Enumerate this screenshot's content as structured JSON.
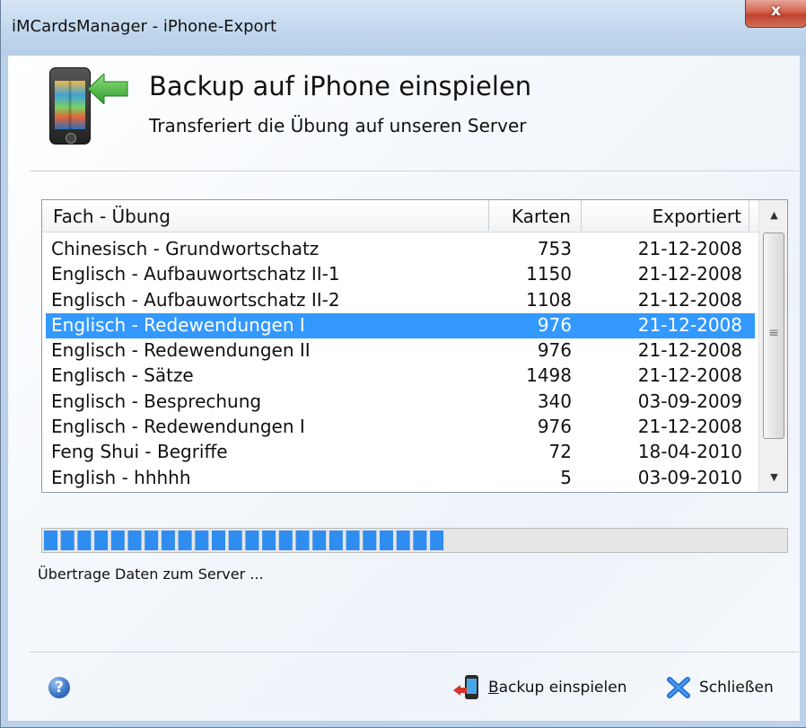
{
  "window": {
    "title": "iMCardsManager - iPhone-Export",
    "close_glyph": "x"
  },
  "header": {
    "title": "Backup auf iPhone einspielen",
    "subtitle": "Transferiert die Übung auf unseren Server",
    "icon": "iphone-with-arrow-icon"
  },
  "list": {
    "columns": [
      "Fach - Übung",
      "Karten",
      "Exportiert"
    ],
    "rows": [
      {
        "name": "Chinesisch - Grundwortschatz",
        "cards": "753",
        "exported": "21-12-2008"
      },
      {
        "name": "Englisch - Aufbauwortschatz II-1",
        "cards": "1150",
        "exported": "21-12-2008"
      },
      {
        "name": "Englisch - Aufbauwortschatz II-2",
        "cards": "1108",
        "exported": "21-12-2008"
      },
      {
        "name": "Englisch - Redewendungen I",
        "cards": "976",
        "exported": "21-12-2008"
      },
      {
        "name": "Englisch - Redewendungen II",
        "cards": "976",
        "exported": "21-12-2008"
      },
      {
        "name": "Englisch - Sätze",
        "cards": "1498",
        "exported": "21-12-2008"
      },
      {
        "name": "Englisch - Besprechung",
        "cards": "340",
        "exported": "03-09-2009"
      },
      {
        "name": "Englisch - Redewendungen I",
        "cards": "976",
        "exported": "21-12-2008"
      },
      {
        "name": "Feng Shui - Begriffe",
        "cards": "72",
        "exported": "18-04-2010"
      },
      {
        "name": "English - hhhhh",
        "cards": "5",
        "exported": "03-09-2010"
      }
    ],
    "selected_index": 3,
    "scroll_up": "▲",
    "scroll_down": "▼",
    "scroll_grip": "≡"
  },
  "progress": {
    "fraction": 0.54,
    "segments_filled": 24,
    "color": "#2f8df0"
  },
  "status": {
    "text": "Übertrage Daten zum Server ..."
  },
  "footer": {
    "help_glyph": "?",
    "backup_button": {
      "mnemonic": "B",
      "rest": "ackup einspielen",
      "icon": "phone-export-icon"
    },
    "close_button": {
      "label": "Schließen",
      "icon": "close-x-icon"
    }
  },
  "colors": {
    "selection": "#3399ff",
    "accent_blue": "#1f6fd8",
    "close_red": "#c0432c"
  }
}
